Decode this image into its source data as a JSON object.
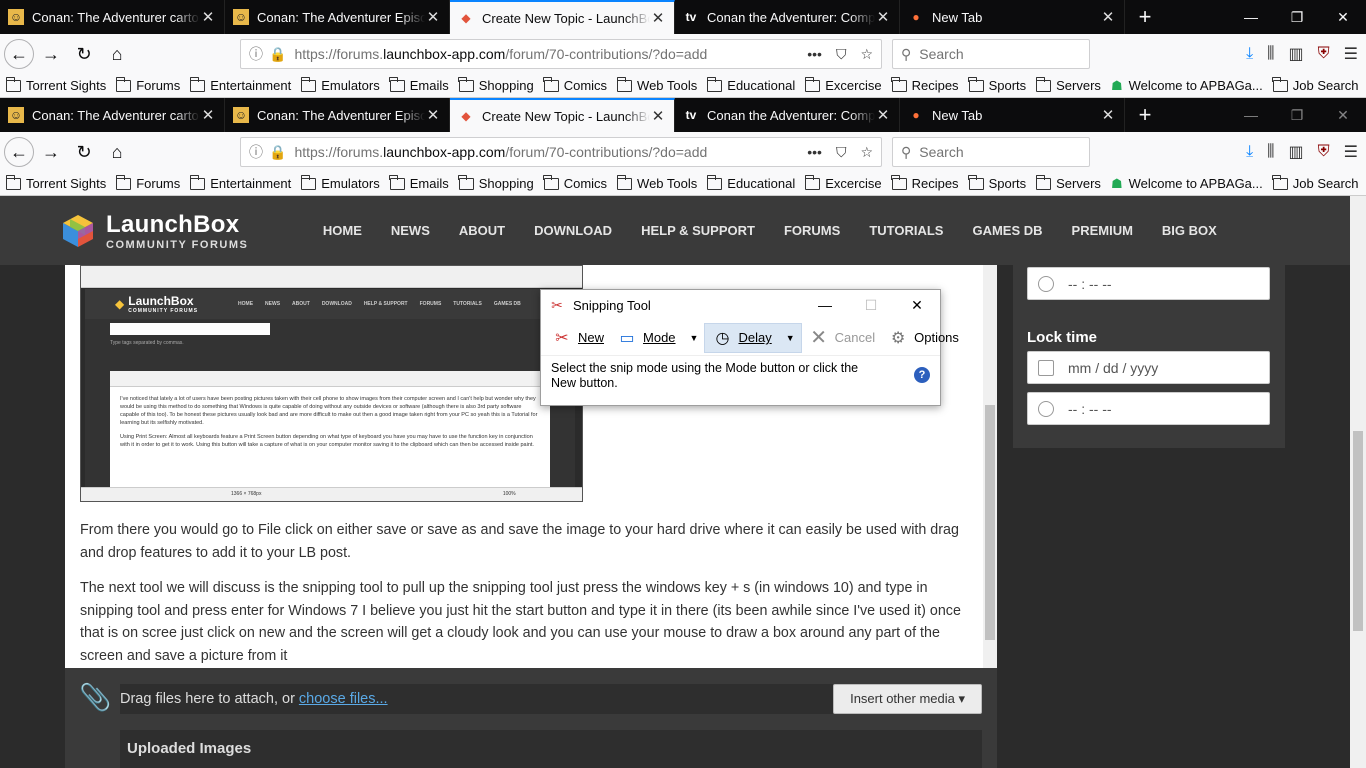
{
  "browser": {
    "tabs": [
      {
        "title": "Conan: The Adventurer cartoon",
        "icon": "conan-icon"
      },
      {
        "title": "Conan: The Adventurer Episode",
        "icon": "conan-icon"
      },
      {
        "title": "Create New Topic - LaunchBox",
        "icon": "launchbox-icon"
      },
      {
        "title": "Conan the Adventurer: Comple",
        "icon": "tv-icon"
      },
      {
        "title": "New Tab",
        "icon": "firefox-icon"
      }
    ],
    "url_prefix": "https://forums.",
    "url_domain": "launchbox-app.com",
    "url_path": "/forum/70-contributions/?do=add",
    "search_placeholder": "Search",
    "bookmarks": [
      "Torrent Sights",
      "Forums",
      "Entertainment",
      "Emulators",
      "Emails",
      "Shopping",
      "Comics",
      "Web Tools",
      "Educational",
      "Excercise",
      "Recipes",
      "Sports",
      "Servers",
      "Welcome to APBAGa...",
      "Job Search"
    ],
    "accent": "#0a84ff"
  },
  "site": {
    "logo_big": "LaunchBox",
    "logo_small": "COMMUNITY FORUMS",
    "nav": [
      "HOME",
      "NEWS",
      "ABOUT",
      "DOWNLOAD",
      "HELP & SUPPORT",
      "FORUMS",
      "TUTORIALS",
      "GAMES DB",
      "PREMIUM",
      "BIG BOX"
    ],
    "para1": "From there you would go to File click on either save or save as  and save the image to your hard drive where it can easily be used with drag and drop features to add it to your LB post.",
    "para2": "The next tool we will discuss is the snipping tool to pull up the snipping tool just press the windows key + s (in windows 10) and type in snipping tool and press enter for Windows 7 I believe you just hit the start button and type it in there (its been awhile since I've used it) once that is on scree just click on new and the screen will get a cloudy look and you can use your mouse to draw a box around any part of the screen and save a picture from it",
    "sidebar": {
      "time_placeholder_1": "-- : --  --",
      "lock_time_label": "Lock time",
      "date_placeholder": "mm / dd / yyyy",
      "time_placeholder_2": "-- : --  --"
    },
    "attach": {
      "drag_text": "Drag files here to attach, or",
      "choose_link": "choose files...",
      "insert_button": "Insert other media ▾",
      "uploaded_title": "Uploaded Images"
    },
    "embedded_shot": {
      "logo": "LaunchBox",
      "logo_small": "COMMUNITY FORUMS",
      "nav": [
        "HOME",
        "NEWS",
        "ABOUT",
        "DOWNLOAD",
        "HELP & SUPPORT",
        "FORUMS",
        "TUTORIALS",
        "GAMES DB"
      ],
      "tags_hint": "Type tags separated by commas.",
      "body": "I've noticed that lately a lot of users have been posting pictures taken with their cell phone to show images from their computer screen and I can't help but wonder why they would be using this method to do something that Windows is quite capable of doing without any outside devices or software (although there is also 3rd party software capable of this too). To be honest these pictures usually look bad and are more difficult to make out then a good image taken right from your PC so yeah this is a Tutorial for learning but its selfishly motivated.",
      "body2": "Using Print Screen: Almost all keyboards feature a Print Screen button depending on what type of keyboard you have you may have to use the function key in conjunction with it in order to get it to work. Using this button will take a capture of what is on your computer monitor saving it to the clipboard which can then be accessed inside paint.",
      "status_size": "1366 × 768px",
      "status_zoom": "100%"
    }
  },
  "snipping_tool": {
    "title": "Snipping Tool",
    "new_label": "New",
    "mode_label": "Mode",
    "delay_label": "Delay",
    "cancel_label": "Cancel",
    "options_label": "Options",
    "message": "Select the snip mode using the Mode button or click the New button."
  }
}
